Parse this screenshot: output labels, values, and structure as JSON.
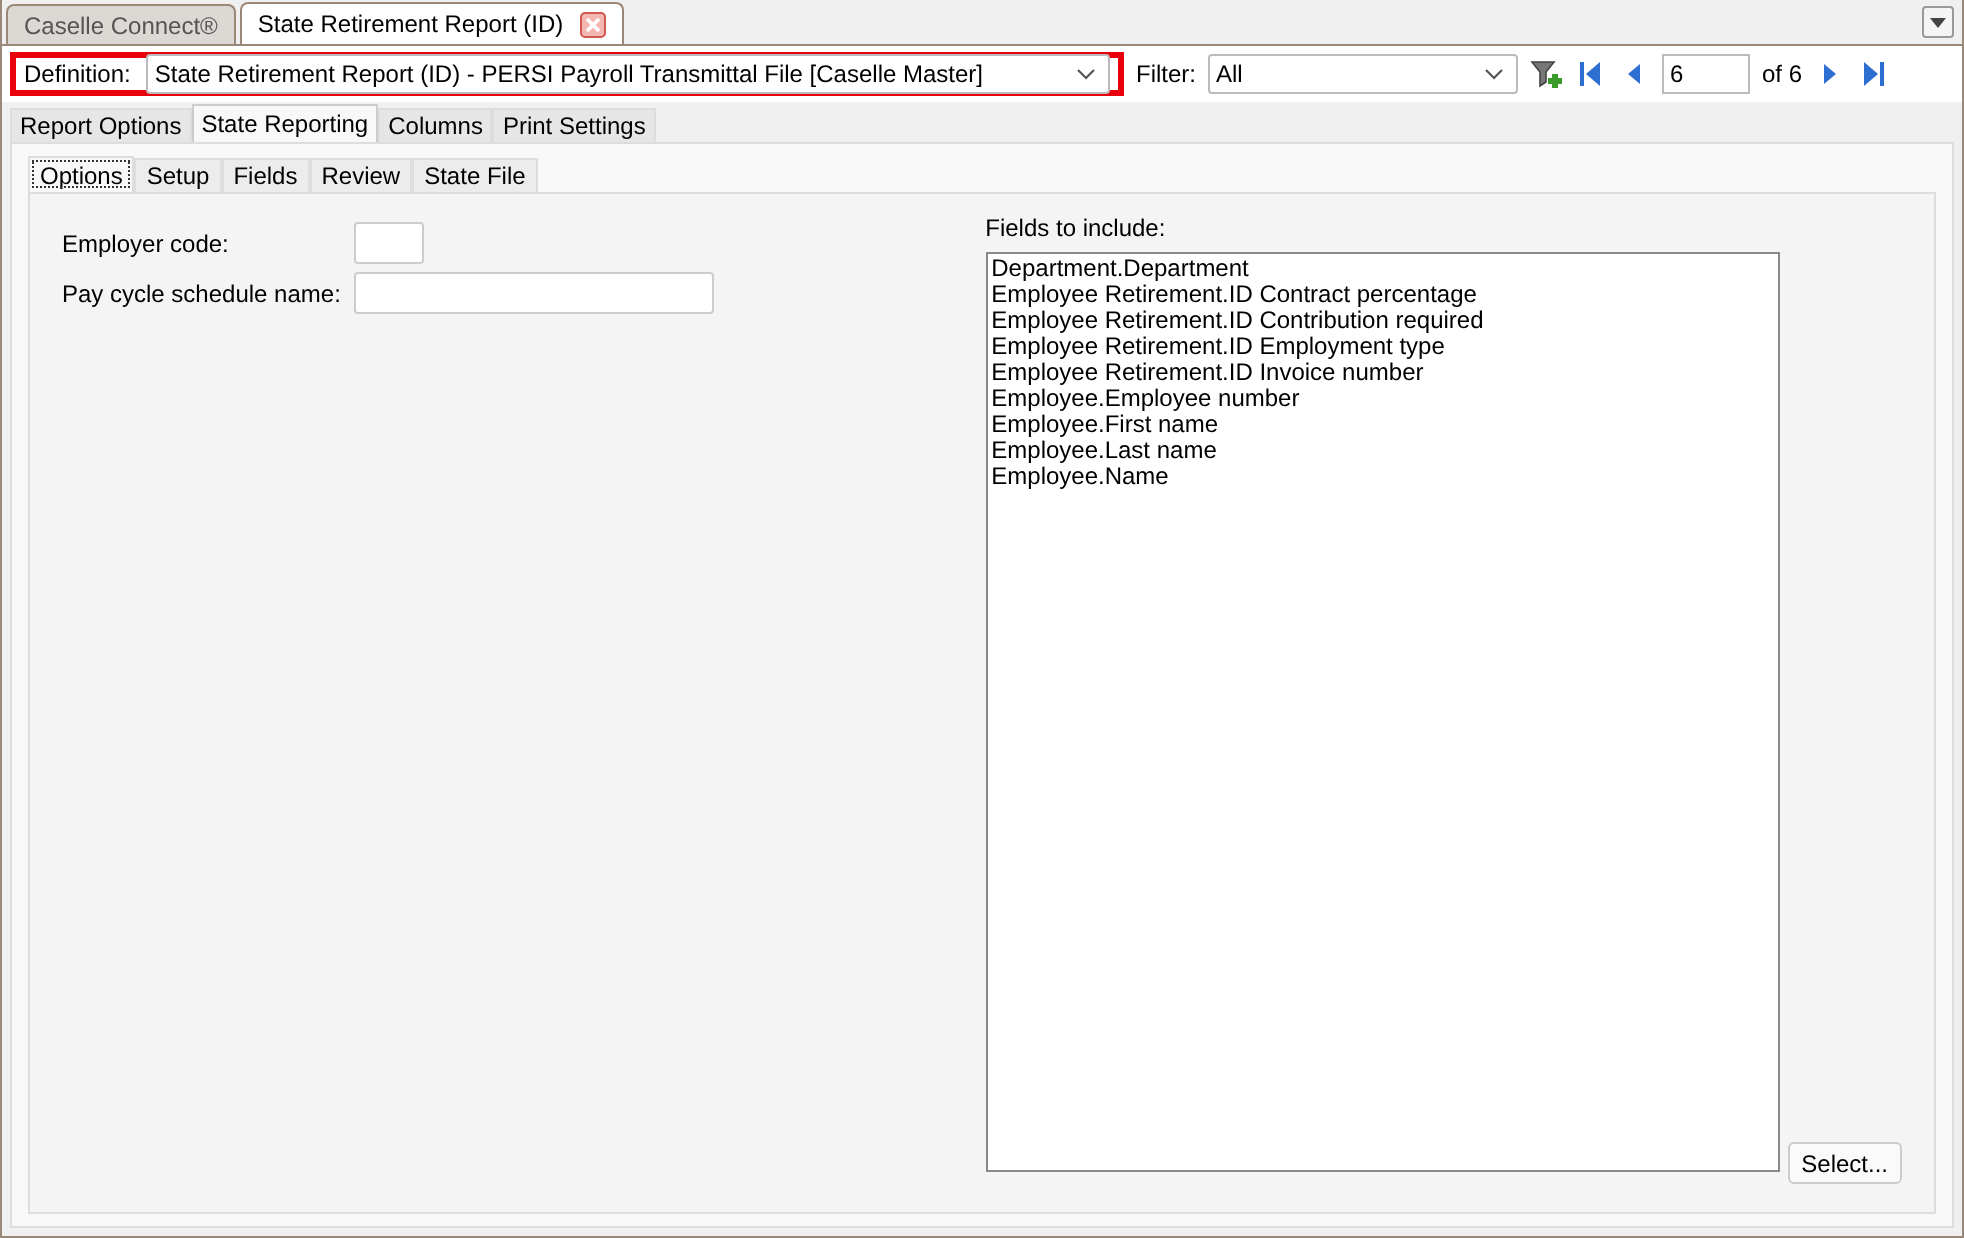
{
  "document_tabs": [
    {
      "label": "Caselle Connect®",
      "selected": false,
      "closable": false
    },
    {
      "label": "State Retirement Report (ID)",
      "selected": true,
      "closable": true
    }
  ],
  "toolbar": {
    "definition": {
      "label": "Definition:",
      "value": "State Retirement Report (ID) - PERSI Payroll Transmittal File [Caselle Master]",
      "highlighted": true
    },
    "filter": {
      "label": "Filter:",
      "value": "All"
    },
    "record": {
      "value": "6",
      "total": "of 6"
    }
  },
  "tabs": [
    {
      "label": "Report Options",
      "selected": false
    },
    {
      "label": "State Reporting",
      "selected": true
    },
    {
      "label": "Columns",
      "selected": false
    },
    {
      "label": "Print Settings",
      "selected": false
    }
  ],
  "subtabs": [
    {
      "label": "Options",
      "selected": true
    },
    {
      "label": "Setup",
      "selected": false
    },
    {
      "label": "Fields",
      "selected": false
    },
    {
      "label": "Review",
      "selected": false
    },
    {
      "label": "State File",
      "selected": false
    }
  ],
  "form": [
    {
      "label": "Employer code:"
    },
    {
      "label": "Pay cycle schedule name:"
    }
  ],
  "fields_to_include": {
    "label": "Fields to include:",
    "items": [
      "Department.Department",
      "Employee Retirement.ID Contract percentage",
      "Employee Retirement.ID Contribution required",
      "Employee Retirement.ID Employment type",
      "Employee Retirement.ID Invoice number",
      "Employee.Employee number",
      "Employee.First name",
      "Employee.Last name",
      "Employee.Name"
    ],
    "button": "Select..."
  }
}
